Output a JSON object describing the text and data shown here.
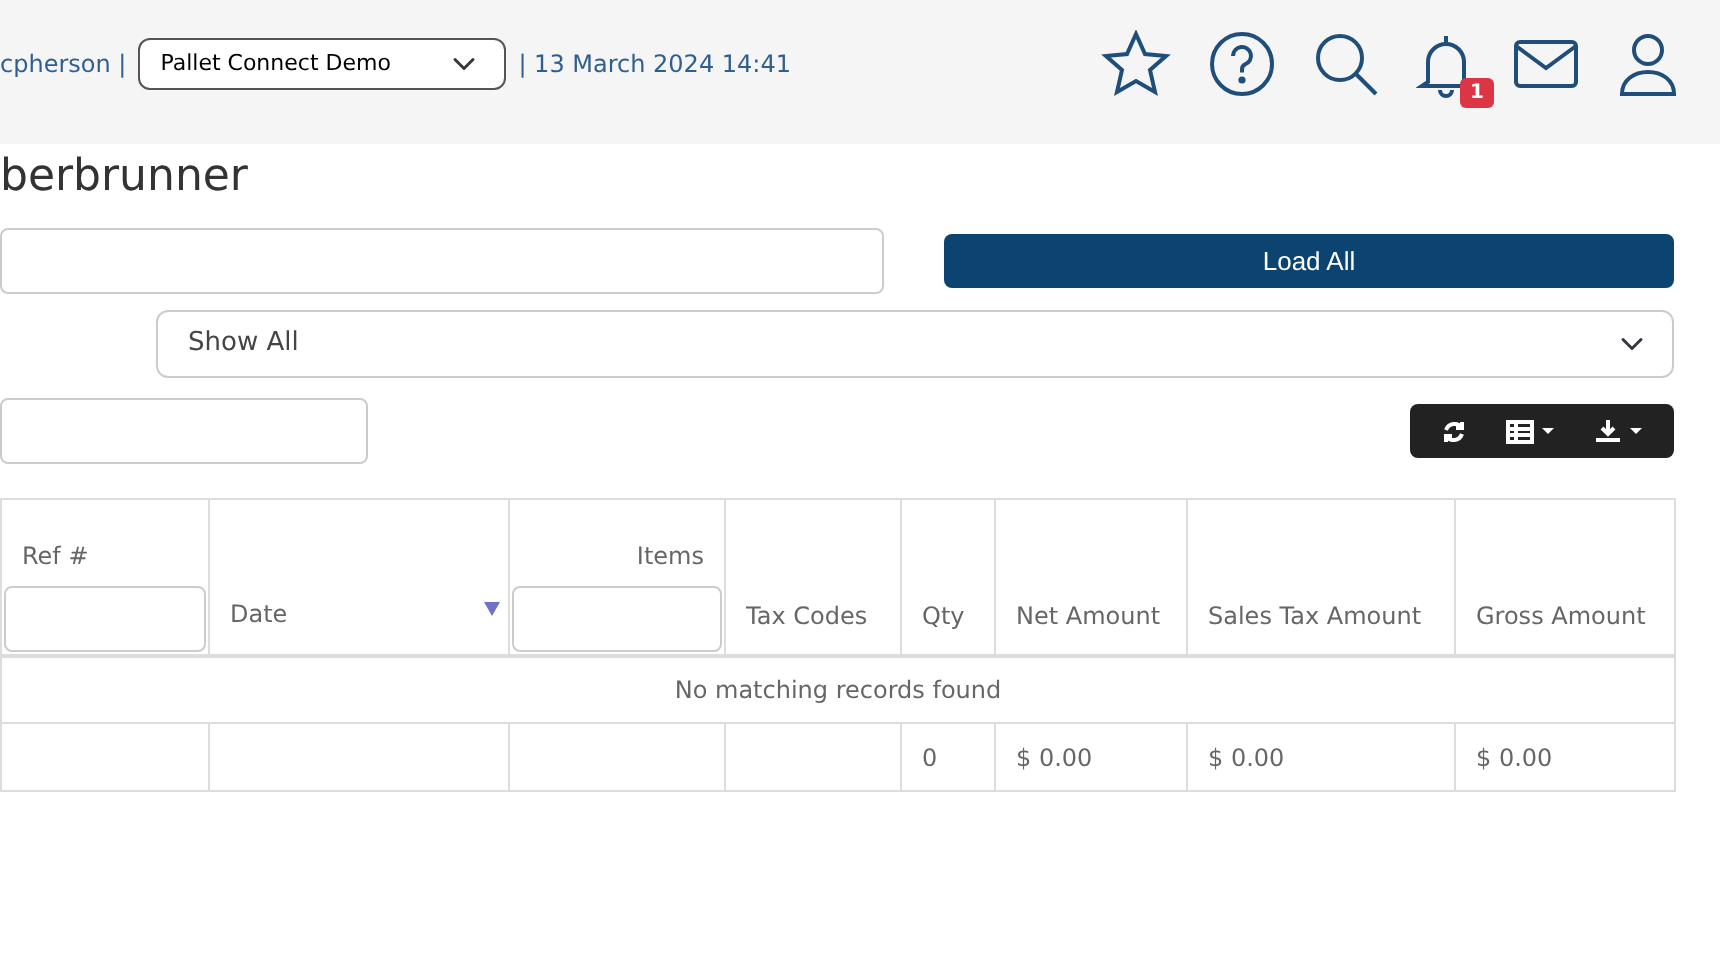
{
  "header": {
    "user_text": "cpherson |",
    "company_select": {
      "value": "Pallet Connect Demo"
    },
    "date_text": "| 13 March 2024 14:41",
    "notification_count": "1"
  },
  "page_title": "berbrunner",
  "load_button": "Load All",
  "status_filter": {
    "value": "Show All"
  },
  "table": {
    "columns": [
      {
        "label": "Ref #",
        "kind": "filter"
      },
      {
        "label": "Date",
        "kind": "sort"
      },
      {
        "label": "Items",
        "kind": "filter"
      },
      {
        "label": "Tax Codes",
        "kind": "plain"
      },
      {
        "label": "Qty",
        "kind": "plain"
      },
      {
        "label": "Net Amount",
        "kind": "plain"
      },
      {
        "label": "Sales Tax Amount",
        "kind": "plain"
      },
      {
        "label": "Gross Amount",
        "kind": "plain"
      }
    ],
    "empty_message": "No matching records found",
    "totals": [
      "0",
      "$ 0.00",
      "$ 0.00",
      "$ 0.00"
    ]
  }
}
